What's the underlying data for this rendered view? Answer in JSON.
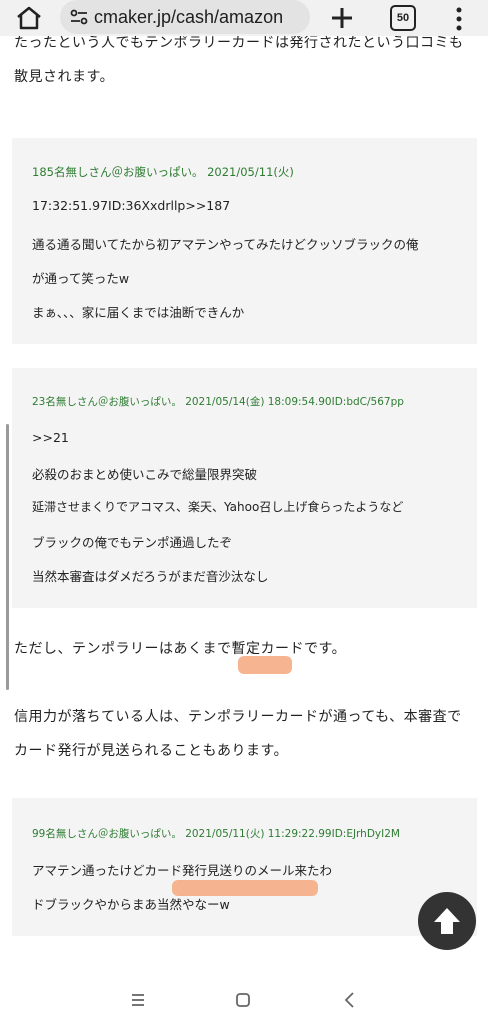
{
  "browser": {
    "url": "cmaker.jp/cash/amazon",
    "tab_count": "50"
  },
  "article": {
    "top_para_line1": "たったという人でもテンポラリーカードは発行されたという口コミも",
    "top_para_line2": "散見されます。",
    "quotes": [
      {
        "header": "185名無しさん＠お腹いっぱい。 2021/05/11(火)",
        "lines": [
          "17:32:51.97ID:36Xxdrllp>>187",
          "通る通る聞いてたから初アマテンやってみたけどクッソブラックの俺",
          "が通って笑ったw",
          "まぁ、、、家に届くまでは油断できんか"
        ]
      },
      {
        "header": "23名無しさん＠お腹いっぱい。 2021/05/14(金) 18:09:54.90ID:bdC/567pp",
        "lines": [
          ">>21",
          "必殺のおまとめ使いこみで総量限界突破",
          "延滞させまくりでアコマス、楽天、Yahoo召し上げ食らったようなど",
          "ブラックの俺でもテンポ通過したぞ",
          "当然本審査はダメだろうがまだ音沙汰なし"
        ]
      },
      {
        "header": "99名無しさん＠お腹いっぱい。 2021/05/11(火) 11:29:22.99ID:EJrhDyI2M",
        "lines": [
          "アマテン通ったけどカード発行見送りのメール来たわ",
          "ドブラックやからまあ当然やなーw"
        ]
      }
    ],
    "mid_para": "ただし、テンポラリーはあくまで暫定カードです。",
    "bottom_para_line1": "信用力が落ちている人は、テンポラリーカードが通っても、本審査で",
    "bottom_para_line2": "カード発行が見送られることもあります。"
  },
  "colors": {
    "highlight": "#f5a87c",
    "quote_header": "#2e7d32",
    "quote_bg": "#f4f4f4"
  },
  "icons": {
    "home": "home-icon",
    "site_settings": "site-settings-icon",
    "new_tab": "plus-icon",
    "menu": "more-vert-icon",
    "scroll_top": "arrow-up-icon",
    "nav_recents": "recents-icon",
    "nav_home": "nav-home-icon",
    "nav_back": "back-icon"
  }
}
